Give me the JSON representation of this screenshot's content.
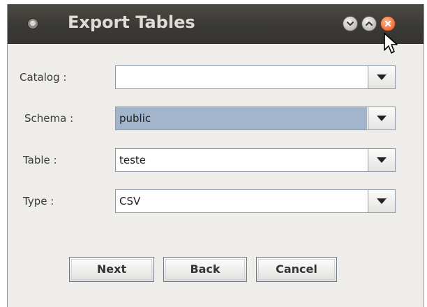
{
  "window": {
    "title": "Export Tables"
  },
  "form": {
    "catalog": {
      "label": "Catalog :",
      "value": ""
    },
    "schema": {
      "label": "Schema :",
      "value": "public"
    },
    "table": {
      "label": "Table :",
      "value": "teste"
    },
    "type": {
      "label": "Type :",
      "value": "CSV"
    }
  },
  "buttons": {
    "next": "Next",
    "back": "Back",
    "cancel": "Cancel"
  },
  "icons": {
    "menu": "window-menu-icon",
    "minimize": "minimize-icon",
    "maximize": "maximize-icon",
    "close": "close-icon",
    "dropdown": "chevron-down-icon",
    "cursor": "mouse-pointer-icon"
  },
  "colors": {
    "titlebar": "#3b3a36",
    "title_text": "#e0dcd5",
    "close_button": "#f0743f",
    "selection": "#a2b5cc",
    "dialog_background": "#efedea"
  }
}
